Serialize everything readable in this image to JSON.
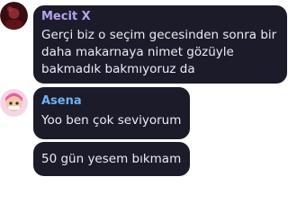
{
  "colors": {
    "bubble": "#1c1b2a",
    "sender_mecit": "#b5a4ec",
    "sender_asena": "#6fb1f3",
    "text": "#ececf2"
  },
  "messages": [
    {
      "sender": "Mecit X",
      "avatar_icon": "user-avatar-mecit",
      "lines": [
        "Gerçi biz o seçim gecesinden sonra bir",
        "daha makarnaya nimet gözüyle",
        "bakmadık bakmıyoruz da"
      ]
    },
    {
      "sender": "Asena",
      "avatar_icon": "user-avatar-asena",
      "lines": [
        "Yoo ben çok seviyorum"
      ]
    },
    {
      "sender": "",
      "lines": [
        "50 gün yesem bıkmam"
      ]
    }
  ]
}
